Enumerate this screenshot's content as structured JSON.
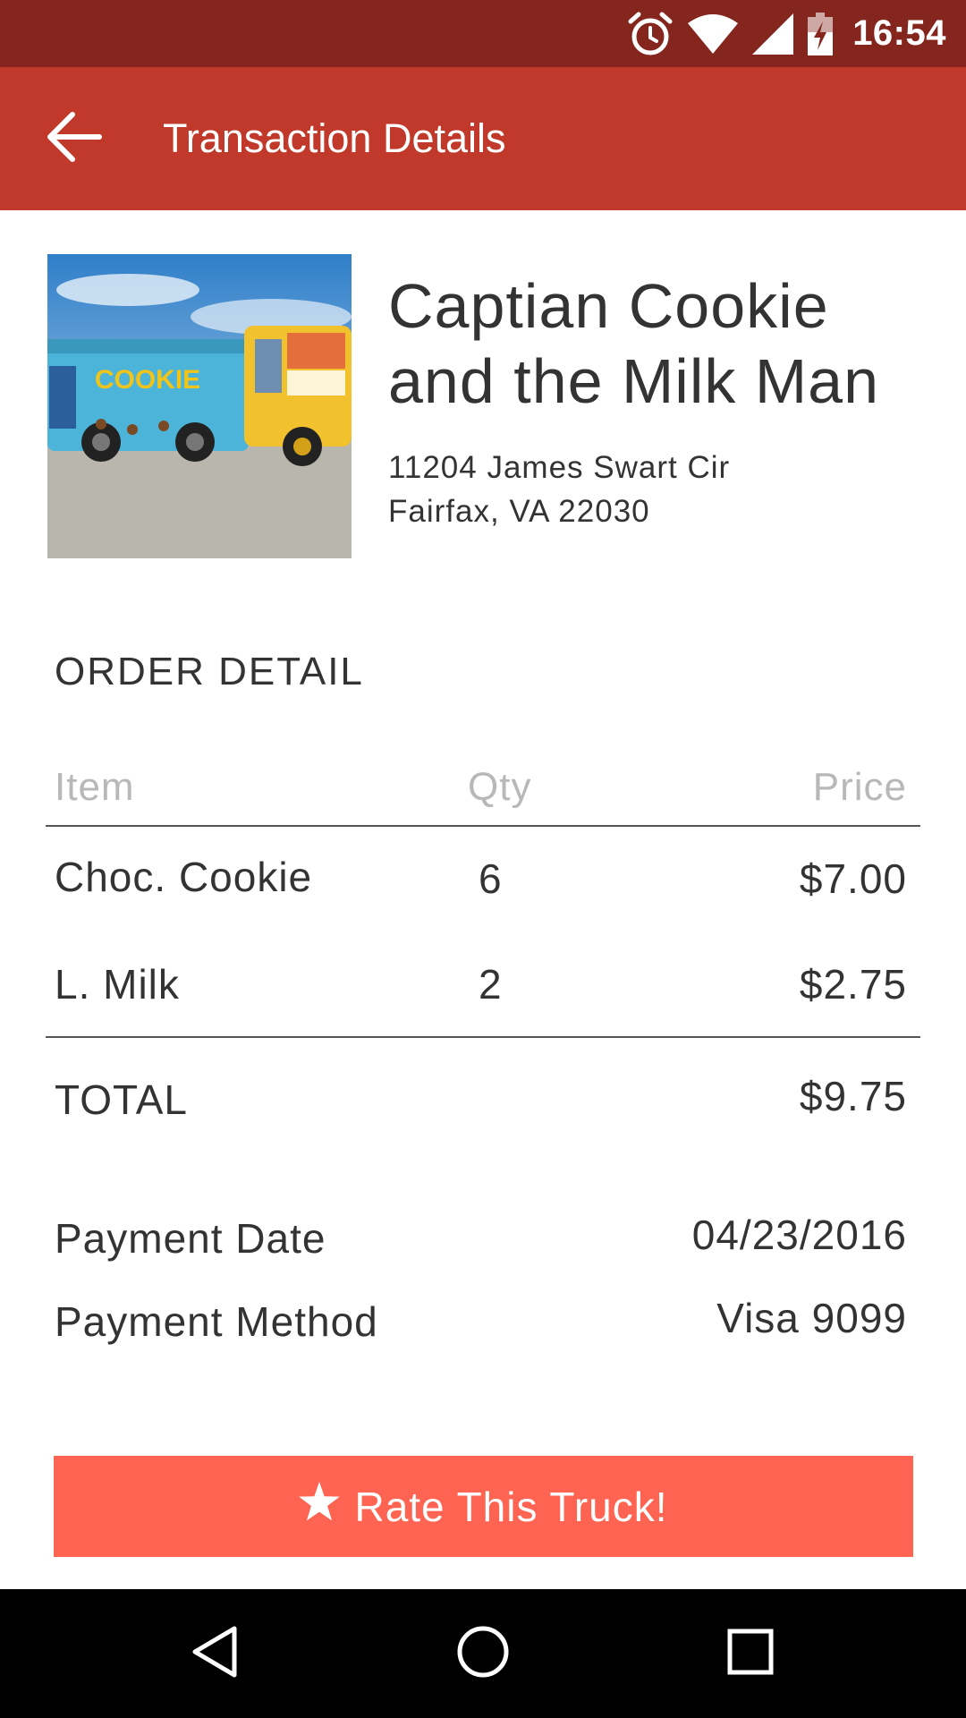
{
  "status_bar": {
    "time": "16:54",
    "icons": [
      "alarm-icon",
      "wifi-icon",
      "signal-icon",
      "battery-charging-icon"
    ]
  },
  "app_bar": {
    "title": "Transaction Details",
    "back_icon": "arrow-back-icon"
  },
  "truck": {
    "name_line1": "Captian Cookie",
    "name_line2": "and the Milk Man",
    "address_line1": "11204 James Swart Cir",
    "address_line2": "Fairfax, VA 22030"
  },
  "order": {
    "section_title": "ORDER DETAIL",
    "headers": {
      "item": "Item",
      "qty": "Qty",
      "price": "Price"
    },
    "rows": [
      {
        "item": "Choc. Cookie",
        "qty": "6",
        "price": "$7.00"
      },
      {
        "item": "L. Milk",
        "qty": "2",
        "price": "$2.75"
      }
    ],
    "total_label": "TOTAL",
    "total_value": "$9.75"
  },
  "payment": {
    "date_label": "Payment Date",
    "date_value": "04/23/2016",
    "method_label": "Payment Method",
    "method_value": "Visa 9099"
  },
  "rate_button": {
    "label": "Rate This Truck!",
    "icon": "star-icon"
  },
  "nav_bar": {
    "icons": [
      "back-triangle-icon",
      "home-circle-icon",
      "recents-square-icon"
    ]
  },
  "colors": {
    "status_bar": "#84261e",
    "app_bar": "#c0392b",
    "button": "#ff6352",
    "header_text": "#b8b8b8"
  }
}
